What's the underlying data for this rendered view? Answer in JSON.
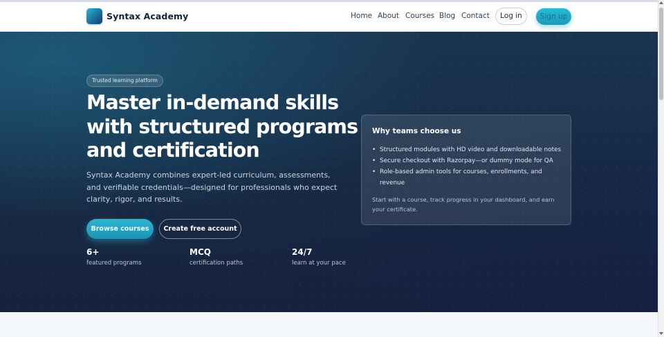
{
  "nav": {
    "brand": "Syntax Academy",
    "brand_icon": "academy-logo-icon",
    "links": [
      "Home",
      "About",
      "Courses",
      "Blog",
      "Contact"
    ],
    "login_label": "Log in",
    "signup_label": "Sign up"
  },
  "hero": {
    "badge": "Trusted learning platform",
    "headline_lines": [
      "Master in-demand skills",
      "with structured programs",
      "and certification"
    ],
    "lead_lines": [
      "Syntax Academy combines expert-led curriculum, assessments,",
      "and verifiable credentials—designed for professionals who expect",
      "clarity, rigor, and results."
    ],
    "primary_cta": "Browse courses",
    "secondary_cta": "Create free account",
    "stats": [
      {
        "value": "6+",
        "label": "featured programs"
      },
      {
        "value": "MCQ",
        "label": "certification paths"
      },
      {
        "value": "24/7",
        "label": "learn at your pace"
      }
    ]
  },
  "card": {
    "title": "Why teams choose us",
    "items": [
      "Structured modules with HD video and downloadable notes",
      "Secure checkout with Razorpay—or dummy mode for QA",
      "Role-based admin tools for courses, enrollments, and",
      "revenue"
    ],
    "footer_lines": [
      "Start with a course, track progress in your dashboard, and earn",
      "your certificate."
    ]
  },
  "colors": {
    "accent": "#22aacb",
    "hero_bg": "#17263f",
    "brand_text": "#142238"
  }
}
